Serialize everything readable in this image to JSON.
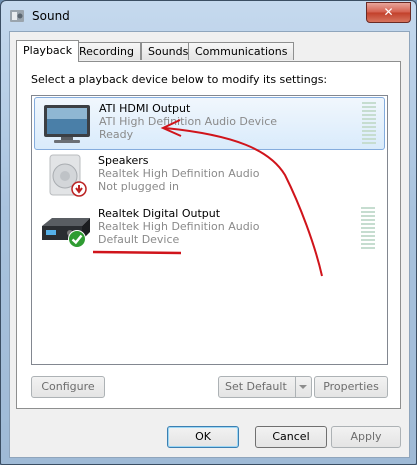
{
  "window": {
    "title": "Sound",
    "close_glyph": "✕"
  },
  "tabs": [
    {
      "label": "Playback"
    },
    {
      "label": "Recording"
    },
    {
      "label": "Sounds"
    },
    {
      "label": "Communications"
    }
  ],
  "instruction": "Select a playback device below to modify its settings:",
  "devices": [
    {
      "name": "ATI HDMI Output",
      "description": "ATI High Definition Audio Device",
      "status": "Ready",
      "icon": "monitor-icon",
      "selected": true
    },
    {
      "name": "Speakers",
      "description": "Realtek High Definition Audio",
      "status": "Not plugged in",
      "icon": "speaker-icon"
    },
    {
      "name": "Realtek Digital Output",
      "description": "Realtek High Definition Audio",
      "status": "Default Device",
      "icon": "digital-output-icon",
      "badge": "check-icon"
    }
  ],
  "panel_buttons": {
    "configure": "Configure",
    "set_default": "Set Default",
    "properties": "Properties"
  },
  "dialog_buttons": {
    "ok": "OK",
    "cancel": "Cancel",
    "apply": "Apply"
  },
  "annotation_color": "#d0141b"
}
